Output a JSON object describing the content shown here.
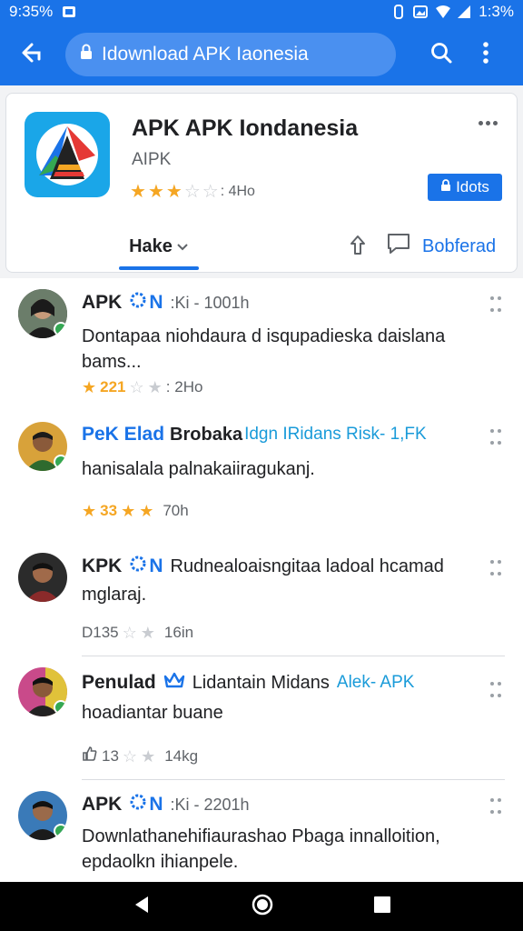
{
  "status": {
    "time": "9:35%",
    "battery": "1:3%"
  },
  "browser": {
    "url_text": "Idownload APK Iaonesia"
  },
  "app": {
    "title": "APK APK Iondanesia",
    "developer": "AIPK",
    "rating_text": "4Ho",
    "rating_stars": 2.5,
    "install_label": "Idots",
    "tab_label": "Hake",
    "comment_label": "Bobferad"
  },
  "reviews": [
    {
      "name": "APK",
      "badge": "N",
      "meta": ":Ki - 1001h",
      "tag": "",
      "text": "Dontapaa niohdaura d isqupadieska daislana bams...",
      "rating_text": "221",
      "rating_meta": "2Ho"
    },
    {
      "name": "PeK Elad",
      "badge": "",
      "meta": "Brobaka",
      "tag": "Idgn IRidans  Risk- 1,FK",
      "text": "hanisalala palnakaiiragukanj.",
      "rating_text": "33",
      "rating_meta": "70h"
    },
    {
      "name": "KPK",
      "badge": "N",
      "meta": "Rudnealoaisngitaa ladoal hcamad",
      "tag": "",
      "text": "mglaraj.",
      "rating_text": "D135",
      "rating_meta": "16in"
    },
    {
      "name": "Penulad",
      "badge": "",
      "meta": "Lidantain Midans",
      "tag": "Alek- APK",
      "text": "hoadiantar buane",
      "rating_text": "13",
      "rating_meta": "14kg"
    },
    {
      "name": "APK",
      "badge": "N",
      "meta": ":Ki - 2201h",
      "tag": "",
      "text": "Downlathanehifiaurashao Pbaga innalloition, epdaolkn ihianpele.",
      "rating_text": "",
      "rating_meta": ""
    }
  ],
  "colors": {
    "accent": "#1a73e8",
    "star": "#f5a623"
  }
}
